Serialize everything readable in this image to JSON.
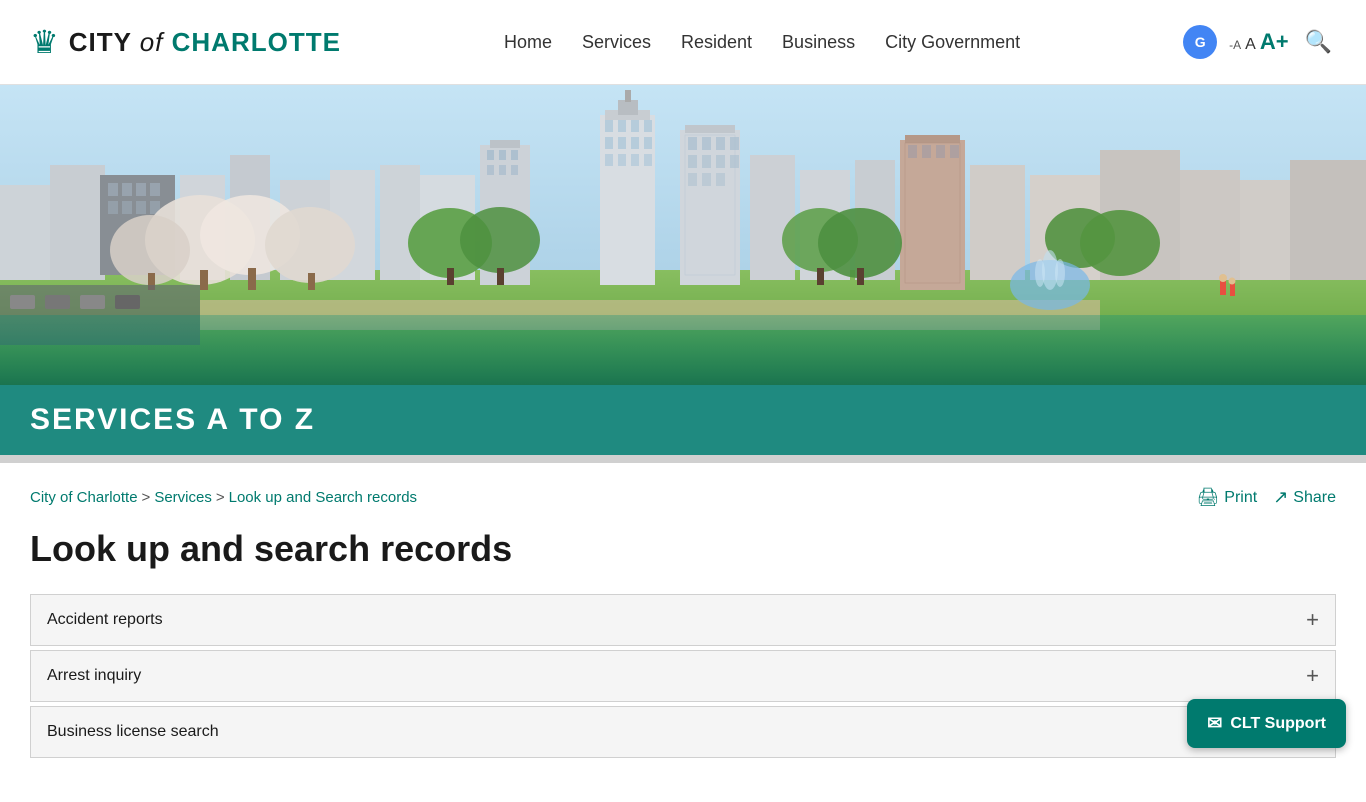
{
  "logo": {
    "city": "CITY",
    "of": "of",
    "charlotte": "CHARLOTTE",
    "crown_icon": "♛"
  },
  "nav": {
    "links": [
      {
        "label": "Home",
        "id": "home"
      },
      {
        "label": "Services",
        "id": "services"
      },
      {
        "label": "Resident",
        "id": "resident"
      },
      {
        "label": "Business",
        "id": "business"
      },
      {
        "label": "City Government",
        "id": "city-government"
      }
    ]
  },
  "header": {
    "translate_label": "G",
    "font_small": "-A",
    "font_medium": "A",
    "font_large": "A+",
    "search_icon": "🔍"
  },
  "hero": {
    "alt": "Charlotte city skyline with park and fountain"
  },
  "page_title": {
    "banner": "SERVICES A TO Z"
  },
  "breadcrumb": {
    "city_of_charlotte": "City of Charlotte",
    "sep1": ">",
    "services": "Services",
    "sep2": ">",
    "current": "Look up and Search records",
    "print_label": "Print",
    "share_label": "Share",
    "print_icon": "🖨",
    "share_icon": "↗"
  },
  "content": {
    "heading": "Look up and search records",
    "accordion_items": [
      {
        "label": "Accident reports",
        "id": "accident-reports"
      },
      {
        "label": "Arrest inquiry",
        "id": "arrest-inquiry"
      },
      {
        "label": "Business license search",
        "id": "business-license"
      }
    ]
  },
  "clt_support": {
    "label": "CLT Support",
    "envelope_icon": "✉"
  }
}
